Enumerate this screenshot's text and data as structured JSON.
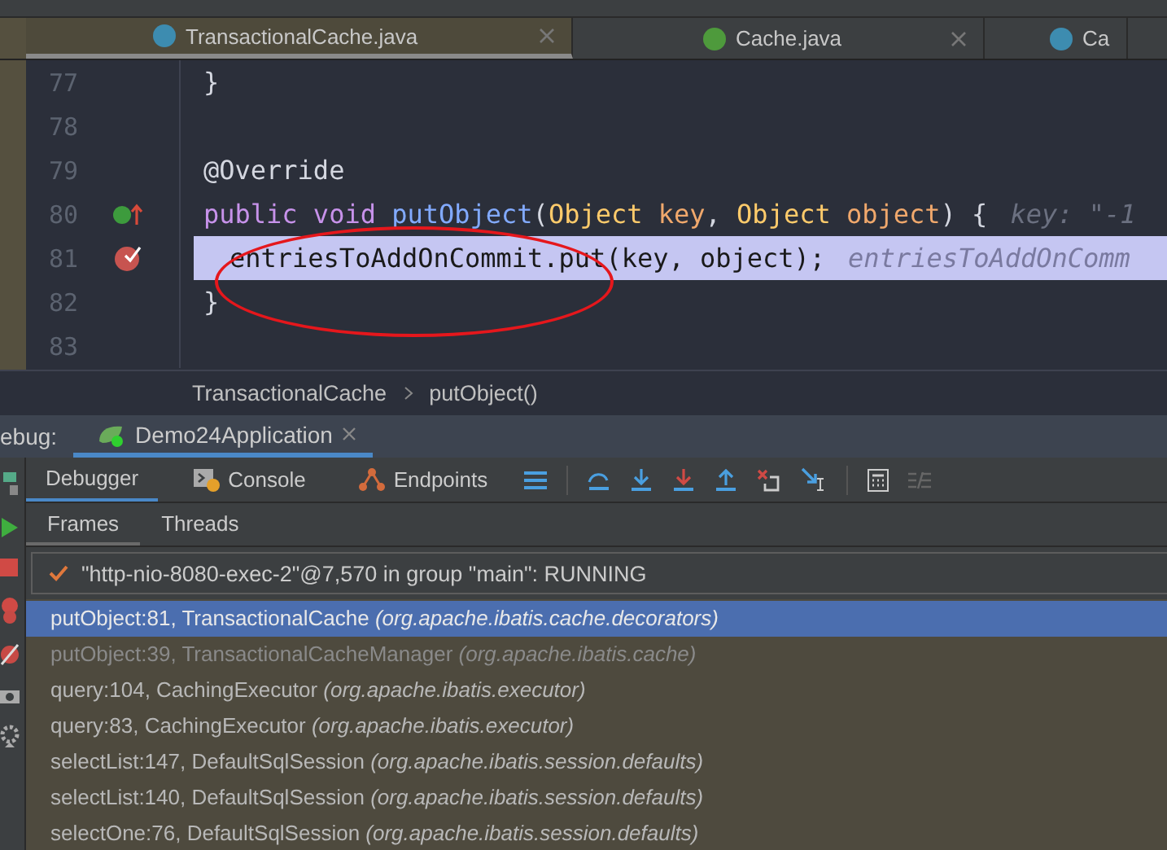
{
  "editor_tabs": [
    {
      "label": "TransactionalCache.java",
      "kind": "class",
      "selected": true,
      "closable": true
    },
    {
      "label": "Cache.java",
      "kind": "interface",
      "selected": false,
      "closable": true
    },
    {
      "label": "Ca",
      "kind": "class",
      "selected": false,
      "closable": false
    }
  ],
  "code_lines": [
    {
      "number": "77",
      "current": false,
      "kind": "plain",
      "tokens": [
        {
          "text": "}",
          "kind": "plain"
        }
      ]
    },
    {
      "number": "78",
      "current": false,
      "kind": "plain"
    },
    {
      "number": "79",
      "current": false,
      "kind": "plain",
      "tokens": [
        {
          "text": "@Override",
          "kind": "annotation"
        }
      ]
    },
    {
      "number": "80",
      "current": false,
      "kind": "implements",
      "tokens": [
        {
          "text": "public void ",
          "kind": "keyword"
        },
        {
          "text": "putObject",
          "kind": "method"
        },
        {
          "text": "(",
          "kind": "plain"
        },
        {
          "text": "Object ",
          "kind": "type"
        },
        {
          "text": "key",
          "kind": "param"
        },
        {
          "text": ", ",
          "kind": "plain"
        },
        {
          "text": "Object ",
          "kind": "type"
        },
        {
          "text": "object",
          "kind": "param"
        },
        {
          "text": ") {",
          "kind": "plain"
        }
      ],
      "hint": "key: \"-1"
    },
    {
      "number": "81",
      "current": true,
      "kind": "breakpoint",
      "tokens": [
        {
          "text": "entriesToAddOnCommit.put(key, object);",
          "kind": "plain"
        }
      ],
      "hint": "entriesToAddOnComm"
    },
    {
      "number": "82",
      "current": false,
      "kind": "plain",
      "tokens": [
        {
          "text": "}",
          "kind": "plain"
        }
      ]
    },
    {
      "number": "83",
      "current": false,
      "kind": "plain"
    }
  ],
  "breadcrumb": [
    "TransactionalCache",
    "putObject()"
  ],
  "debug": {
    "label": "ebug:",
    "session": "Demo24Application",
    "tabs": [
      {
        "label": "Debugger",
        "selected": true
      },
      {
        "label": "Console",
        "selected": false
      },
      {
        "label": "Endpoints",
        "selected": false
      }
    ],
    "sub_tabs": [
      {
        "label": "Frames",
        "selected": true
      },
      {
        "label": "Threads",
        "selected": false
      }
    ],
    "thread": "\"http-nio-8080-exec-2\"@7,570 in group \"main\": RUNNING",
    "frames": [
      {
        "location": "putObject:81, TransactionalCache",
        "package": "(org.apache.ibatis.cache.decorators)",
        "selected": true,
        "dimmed": false
      },
      {
        "location": "putObject:39, TransactionalCacheManager",
        "package": "(org.apache.ibatis.cache)",
        "selected": false,
        "dimmed": true
      },
      {
        "location": "query:104, CachingExecutor",
        "package": "(org.apache.ibatis.executor)",
        "selected": false,
        "dimmed": false
      },
      {
        "location": "query:83, CachingExecutor",
        "package": "(org.apache.ibatis.executor)",
        "selected": false,
        "dimmed": false
      },
      {
        "location": "selectList:147, DefaultSqlSession",
        "package": "(org.apache.ibatis.session.defaults)",
        "selected": false,
        "dimmed": false
      },
      {
        "location": "selectList:140, DefaultSqlSession",
        "package": "(org.apache.ibatis.session.defaults)",
        "selected": false,
        "dimmed": false
      },
      {
        "location": "selectOne:76, DefaultSqlSession",
        "package": "(org.apache.ibatis.session.defaults)",
        "selected": false,
        "dimmed": false
      }
    ]
  }
}
